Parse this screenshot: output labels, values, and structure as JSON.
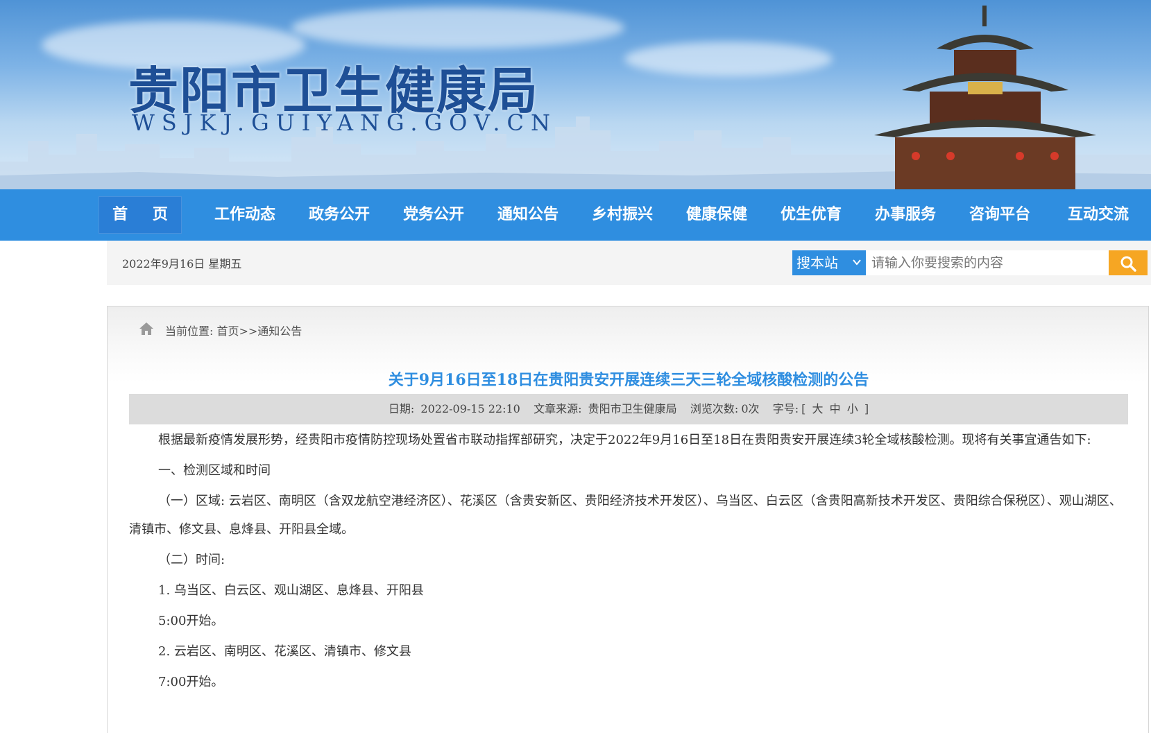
{
  "header": {
    "site_title": "贵阳市卫生健康局",
    "site_domain": "WSJKJ.GUIYANG.GOV.CN"
  },
  "nav": {
    "items": [
      {
        "label": "首 页",
        "active": true
      },
      {
        "label": "工作动态"
      },
      {
        "label": "政务公开"
      },
      {
        "label": "党务公开"
      },
      {
        "label": "通知公告"
      },
      {
        "label": "乡村振兴"
      },
      {
        "label": "健康保健"
      },
      {
        "label": "优生优育"
      },
      {
        "label": "办事服务"
      },
      {
        "label": "咨询平台"
      },
      {
        "label": "互动交流"
      }
    ]
  },
  "infobar": {
    "date": "2022年9月16日  星期五",
    "search_scope": "搜本站",
    "search_placeholder": "请输入你要搜索的内容"
  },
  "breadcrumb": {
    "text": "当前位置: 首页>>通知公告"
  },
  "article": {
    "title": "关于9月16日至18日在贵阳贵安开展连续三天三轮全域核酸检测的公告",
    "meta": {
      "date_label": "日期:",
      "date": "2022-09-15 22:10",
      "source_label": "文章来源:",
      "source": "贵阳市卫生健康局",
      "views_label": "浏览次数:",
      "views": "0次",
      "fontsize_label": "字号:",
      "bracket_open": "[",
      "size_large": "大",
      "size_medium": "中",
      "size_small": "小",
      "bracket_close": "]"
    },
    "paragraphs": [
      "根据最新疫情发展形势，经贵阳市疫情防控现场处置省市联动指挥部研究，决定于2022年9月16日至18日在贵阳贵安开展连续3轮全域核酸检测。现将有关事宜通告如下:",
      "一、检测区域和时间",
      "（一）区域: 云岩区、南明区（含双龙航空港经济区）、花溪区（含贵安新区、贵阳经济技术开发区）、乌当区、白云区（含贵阳高新技术开发区、贵阳综合保税区）、观山湖区、清镇市、修文县、息烽县、开阳县全域。",
      "（二）时间:",
      "1. 乌当区、白云区、观山湖区、息烽县、开阳县",
      "5:00开始。",
      "2. 云岩区、南明区、花溪区、清镇市、修文县",
      "7:00开始。"
    ]
  },
  "colors": {
    "nav_bg": "#2f8ee0",
    "title_blue": "#2f8ee0",
    "search_btn": "#f6a623",
    "brand_dark": "#1e4f96"
  }
}
